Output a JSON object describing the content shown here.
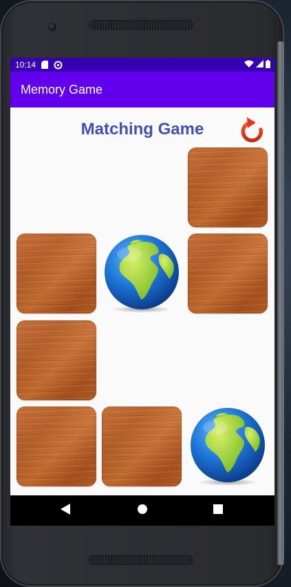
{
  "status_bar": {
    "time": "10:14",
    "left_icons": [
      "sd-card-icon",
      "data-saver-icon"
    ],
    "right_icons": [
      "wifi-icon",
      "cellular-signal-icon",
      "battery-icon"
    ]
  },
  "app_bar": {
    "title": "Memory Game"
  },
  "game": {
    "title": "Matching Game",
    "restart_icon": "refresh-icon",
    "restart_color": "#e8361c",
    "title_color": "#3f51b5",
    "cards": [
      {
        "position": "row1-col3",
        "face": "hidden",
        "image": "wood-back"
      },
      {
        "position": "row2-col1",
        "face": "hidden",
        "image": "wood-back"
      },
      {
        "position": "row2-col2",
        "face": "revealed",
        "image": "earth-globe"
      },
      {
        "position": "row2-col3",
        "face": "hidden",
        "image": "wood-back"
      },
      {
        "position": "row3-col1",
        "face": "hidden",
        "image": "wood-back"
      },
      {
        "position": "row4-col1",
        "face": "hidden",
        "image": "wood-back"
      },
      {
        "position": "row4-col2",
        "face": "hidden",
        "image": "wood-back"
      },
      {
        "position": "row4-col3",
        "face": "revealed",
        "image": "earth-globe"
      }
    ]
  },
  "nav_bar": {
    "buttons": [
      "back-icon",
      "home-icon",
      "recents-icon"
    ]
  },
  "colors": {
    "status_bar": "#3700b3",
    "app_bar": "#6200ee",
    "background": "#fafafa"
  }
}
